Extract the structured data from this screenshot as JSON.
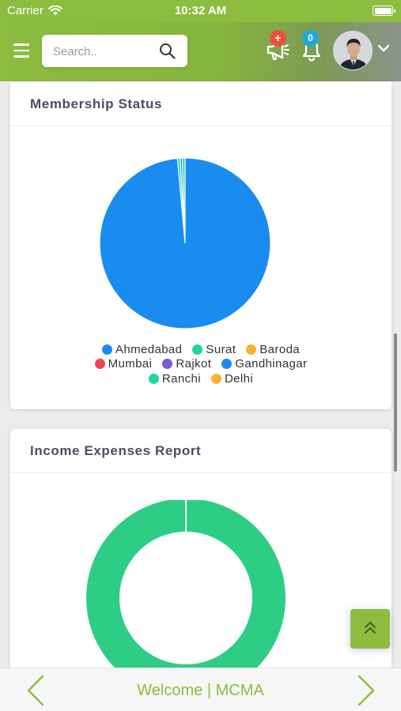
{
  "status_bar": {
    "carrier": "Carrier",
    "time": "10:32 AM"
  },
  "header": {
    "search_placeholder": "Search..",
    "plus_badge": "+",
    "notification_count": "0"
  },
  "membership_card": {
    "title": "Membership Status",
    "legend": [
      {
        "label": "Ahmedabad",
        "color": "#1a8cf0"
      },
      {
        "label": "Surat",
        "color": "#1fd79a"
      },
      {
        "label": "Baroda",
        "color": "#fbb02e"
      },
      {
        "label": "Mumbai",
        "color": "#f0445a"
      },
      {
        "label": "Rajkot",
        "color": "#7a5cd0"
      },
      {
        "label": "Gandhinagar",
        "color": "#1a8cf0"
      },
      {
        "label": "Ranchi",
        "color": "#1fd79a"
      },
      {
        "label": "Delhi",
        "color": "#fbb02e"
      }
    ]
  },
  "income_card": {
    "title": "Income Expenses Report"
  },
  "footer": {
    "welcome": "Welcome | MCMA"
  },
  "chart_data": [
    {
      "type": "pie",
      "title": "Membership Status",
      "categories": [
        "Ahmedabad",
        "Surat",
        "Baroda",
        "Mumbai",
        "Rajkot",
        "Gandhinagar",
        "Ranchi",
        "Delhi"
      ],
      "values": [
        96.5,
        0.5,
        0,
        0,
        0,
        0.4,
        0.5,
        0
      ],
      "colors": [
        "#1a8cf0",
        "#1fd79a",
        "#fbb02e",
        "#f0445a",
        "#7a5cd0",
        "#1a8cf0",
        "#1fd79a",
        "#fbb02e"
      ],
      "legend": "bottom"
    },
    {
      "type": "pie",
      "title": "Income Expenses Report",
      "categories": [
        ""
      ],
      "values": [
        100
      ],
      "colors": [
        "#2ecd85"
      ]
    }
  ]
}
